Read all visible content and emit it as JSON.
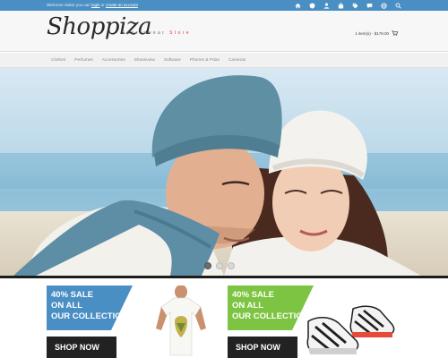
{
  "topbar": {
    "welcome_prefix": "Welcome visitor you can",
    "login_label": "login",
    "or_label": "or",
    "create_label": "create an account",
    "icons": [
      "home-icon",
      "user-shield-icon",
      "user-icon",
      "bag-icon",
      "tag-icon",
      "chat-icon",
      "globe-icon",
      "search-icon"
    ]
  },
  "header": {
    "logo": "Shoppiza",
    "tagline_main": "Sportswear",
    "tagline_accent": "Store",
    "cart_summary": "1 item(s) - $179.00"
  },
  "nav": {
    "items": [
      "Clothes",
      "Perfumes",
      "Accessories",
      "Shoesview",
      "Software",
      "Phones & Pdas",
      "Cameras"
    ]
  },
  "slider": {
    "slide_count": 3,
    "active_index": 0
  },
  "promos": [
    {
      "line1": "40% SALE",
      "line2": "ON ALL",
      "line3": "OUR COLLECTION",
      "button": "SHOP NOW",
      "accent": "#4a8fc4",
      "product": "t-shirt"
    },
    {
      "line1": "40% SALE",
      "line2": "ON ALL",
      "line3": "OUR COLLECTION",
      "button": "SHOP NOW",
      "accent": "#7cc441",
      "product": "sneakers"
    }
  ]
}
